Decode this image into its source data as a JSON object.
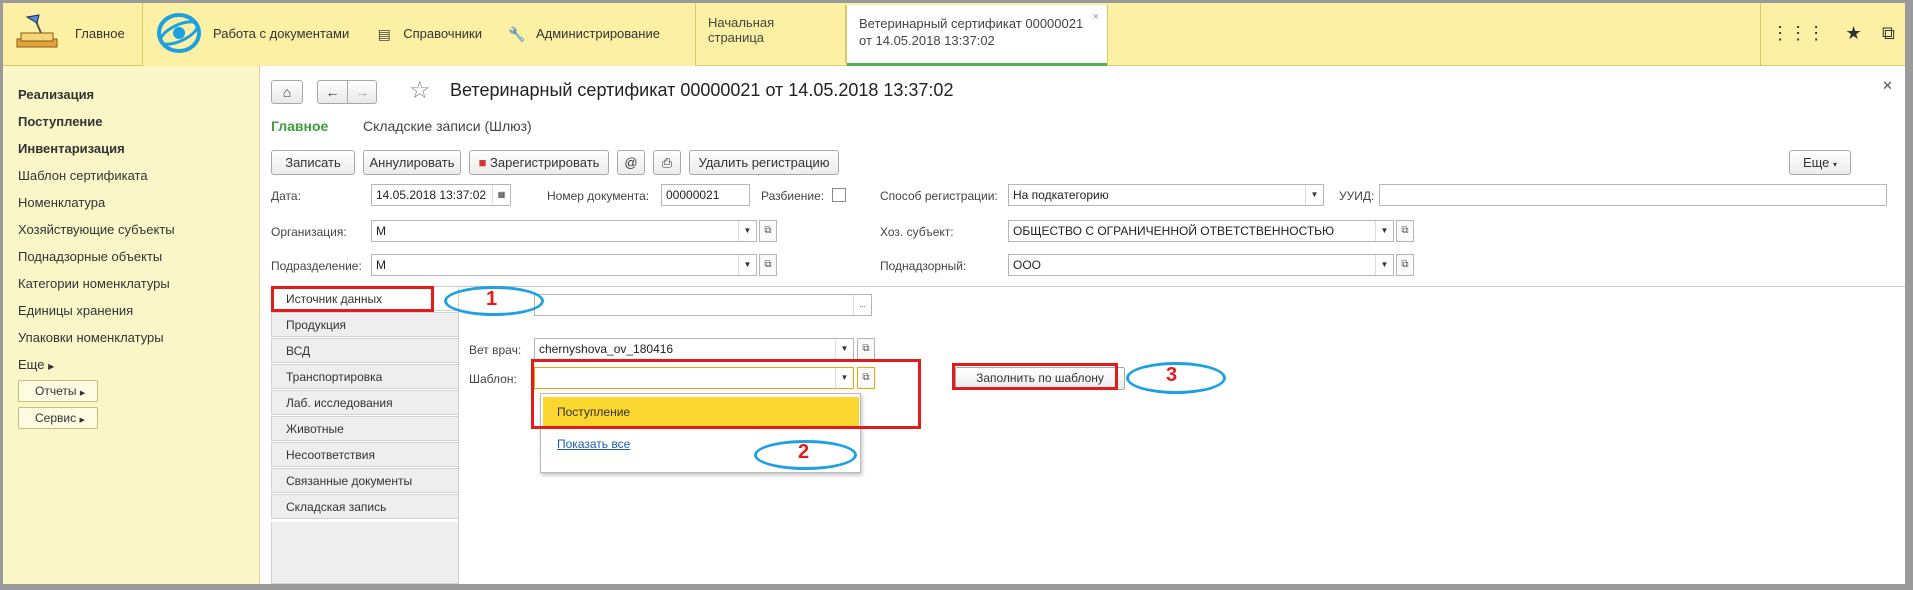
{
  "topbar": {
    "home_label": "Главное",
    "menu": [
      {
        "label": "Работа с документами",
        "icon": "documents-globe-icon"
      },
      {
        "label": "Справочники",
        "icon": "catalog-icon"
      },
      {
        "label": "Администрирование",
        "icon": "wrench-icon"
      }
    ],
    "tabs": [
      {
        "label": "Начальная страница"
      },
      {
        "label": "Ветеринарный сертификат 00000021 от 14.05.2018 13:37:02",
        "close": "×"
      }
    ],
    "right_icons": [
      "grid-icon",
      "star-icon",
      "windows-icon"
    ]
  },
  "sidebar": {
    "items": [
      {
        "label": "Реализация",
        "bold": true
      },
      {
        "label": "Поступление",
        "bold": true
      },
      {
        "label": "Инвентаризация",
        "bold": true
      },
      {
        "label": "Шаблон сертификата"
      },
      {
        "label": "Номенклатура"
      },
      {
        "label": "Хозяйствующие субъекты"
      },
      {
        "label": "Поднадзорные объекты"
      },
      {
        "label": "Категории номенклатуры"
      },
      {
        "label": "Единицы хранения"
      },
      {
        "label": "Упаковки номенклатуры"
      },
      {
        "label": "Еще"
      }
    ],
    "buttons": [
      {
        "label": "Отчеты"
      },
      {
        "label": "Сервис"
      }
    ]
  },
  "form": {
    "title": "Ветеринарный сертификат 00000021 от 14.05.2018 13:37:02",
    "links": {
      "main": "Главное",
      "secondary": "Складские записи (Шлюз)"
    },
    "toolbar": {
      "write": "Записать",
      "annul": "Аннулировать",
      "register": "Зарегистрировать",
      "at": "@",
      "delete_reg": "Удалить регистрацию",
      "more": "Еще"
    },
    "fields": {
      "date_label": "Дата:",
      "date_value": "14.05.2018 13:37:02",
      "docnum_label": "Номер документа:",
      "docnum_value": "00000021",
      "split_label": "Разбиение:",
      "regway_label": "Способ регистрации:",
      "regway_value": "На подкатегорию",
      "uuid_label": "УУИД:",
      "uuid_value": "",
      "org_label": "Организация:",
      "org_value": "М",
      "subj_label": "Хоз. субъект:",
      "subj_value": "ОБЩЕСТВО С ОГРАНИЧЕННОЙ ОТВЕТСТВЕННОСТЬЮ",
      "dept_label": "Подразделение:",
      "dept_value": "М",
      "super_label": "Поднадзорный:",
      "super_value": "ООО"
    },
    "panel_tabs": [
      "Источник данных",
      "Продукция",
      "ВСД",
      "Транспортировка",
      "Лаб. исследования",
      "Животные",
      "Несоответствия",
      "Связанные документы",
      "Складская запись"
    ],
    "source": {
      "vet_label": "Вет врач:",
      "vet_value": "chernyshova_ov_180416",
      "template_label": "Шаблон:",
      "template_value": "",
      "fill_button": "Заполнить по шаблону",
      "dropdown_selected": "Поступление",
      "dropdown_show_all": "Показать все",
      "ellipsis": "..."
    }
  },
  "annotations": {
    "n1": "1",
    "n2": "2",
    "n3": "3"
  }
}
